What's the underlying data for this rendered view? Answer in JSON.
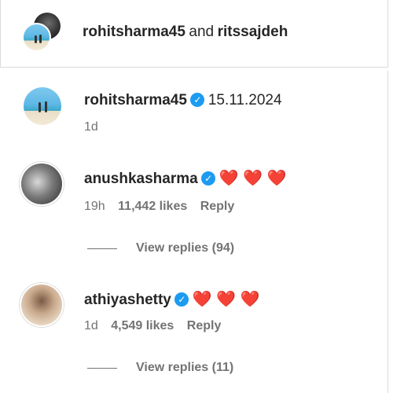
{
  "header": {
    "user1": "rohitsharma45",
    "joiner": "and",
    "user2": "ritssajdeh"
  },
  "post": {
    "username": "rohitsharma45",
    "caption": "15.11.2024",
    "time": "1d"
  },
  "comments": [
    {
      "username": "anushkasharma",
      "hearts": "❤️ ❤️ ❤️",
      "time": "19h",
      "likes": "11,442 likes",
      "reply": "Reply",
      "view_replies": "View replies (94)"
    },
    {
      "username": "athiyashetty",
      "hearts": "❤️ ❤️ ❤️",
      "time": "1d",
      "likes": "4,549 likes",
      "reply": "Reply",
      "view_replies": "View replies (11)"
    }
  ],
  "icons": {
    "verified": "verified-badge-icon",
    "heart": "red-heart-emoji"
  },
  "colors": {
    "verified": "#1d9bf0",
    "heart": "#e0162b",
    "secondary_text": "#737373"
  }
}
